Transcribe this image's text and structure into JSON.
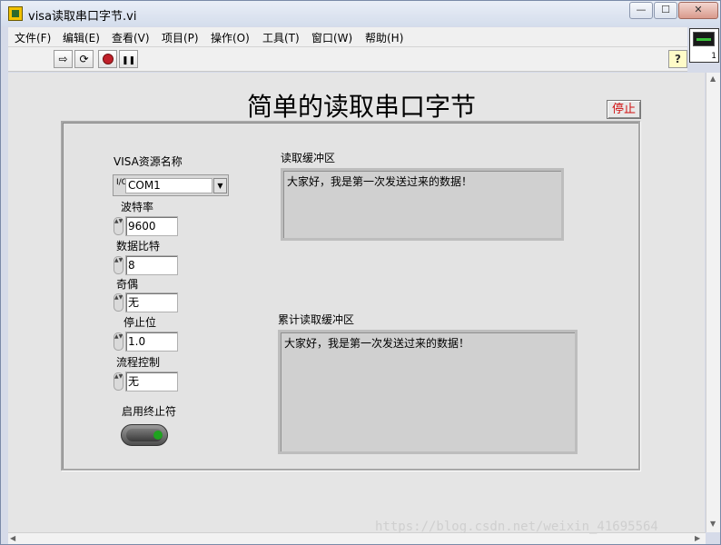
{
  "window": {
    "title": "visa读取串口字节.vi",
    "minimize_label": "—",
    "maximize_label": "☐",
    "close_label": "✕"
  },
  "menu": {
    "items": [
      "文件(F)",
      "编辑(E)",
      "查看(V)",
      "项目(P)",
      "操作(O)",
      "工具(T)",
      "窗口(W)",
      "帮助(H)"
    ]
  },
  "toolbar": {
    "run_icon": "⇨",
    "run_cont_icon": "⟳",
    "pause_icon": "❚❚",
    "help_icon": "?",
    "vi_icon_number": "1"
  },
  "panel": {
    "title": "简单的读取串口字节",
    "stop_label": "停止"
  },
  "controls": {
    "visa_label": "VISA资源名称",
    "visa_io": "I/O",
    "visa_value": "COM1",
    "visa_drop_icon": "▼",
    "baud_label": "波特率",
    "baud_value": "9600",
    "databits_label": "数据比特",
    "databits_value": "8",
    "parity_label": "奇偶",
    "parity_value": "无",
    "stopbits_label": "停止位",
    "stopbits_value": "1.0",
    "flow_label": "流程控制",
    "flow_value": "无",
    "term_label": "启用终止符",
    "term_enabled": true,
    "spin_icon": "▲▼"
  },
  "indicators": {
    "read_label": "读取缓冲区",
    "read_value": "大家好，我是第一次发送过来的数据！",
    "acc_label": "累计读取缓冲区",
    "acc_value": "大家好，我是第一次发送过来的数据！"
  },
  "watermark": "https://blog.csdn.net/weixin_41695564",
  "scroll": {
    "up": "▲",
    "down": "▼",
    "left": "◀",
    "right": "▶"
  }
}
